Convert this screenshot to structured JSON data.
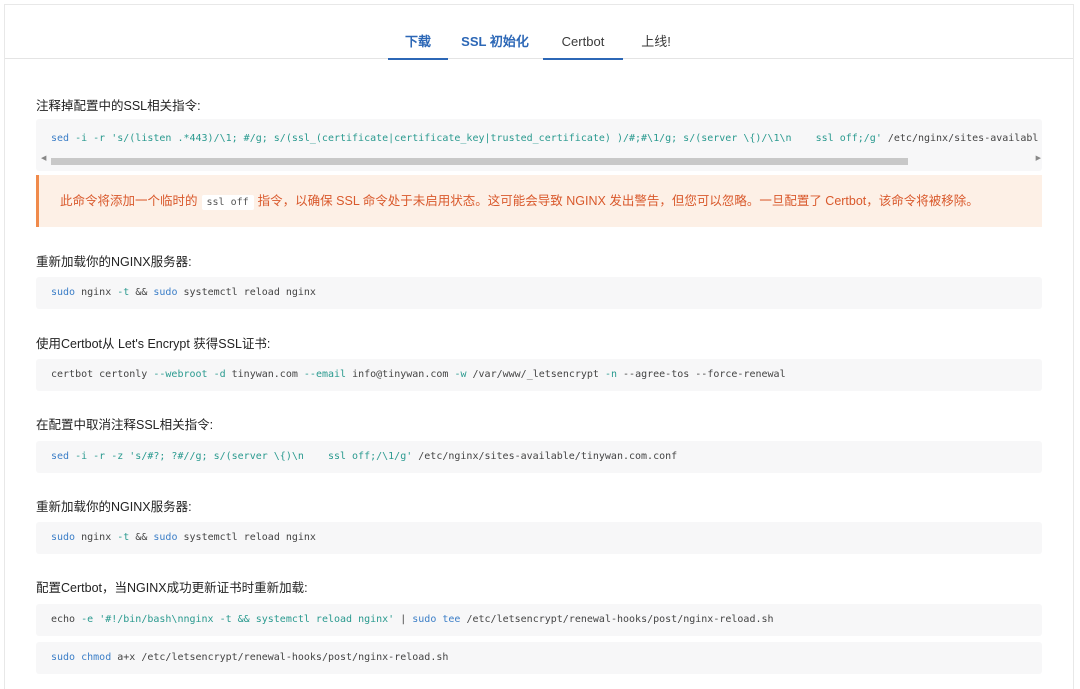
{
  "tabs": [
    {
      "label": "下载"
    },
    {
      "label": "SSL 初始化"
    },
    {
      "label": "Certbot"
    },
    {
      "label": "上线!"
    }
  ],
  "sections": {
    "s1_heading": "注释掉配置中的SSL相关指令:",
    "s2_heading": "重新加载你的NGINX服务器:",
    "s3_heading": "使用Certbot从 Let's Encrypt 获得SSL证书:",
    "s4_heading": "在配置中取消注释SSL相关指令:",
    "s5_heading": "重新加载你的NGINX服务器:",
    "s6_heading": "配置Certbot，当NGINX成功更新证书时重新加载:"
  },
  "warning": {
    "before": "此命令将添加一个临时的",
    "code": "ssl off",
    "after": "指令，以确保 SSL 命令处于未启用状态。这可能会导致 NGINX 发出警告，但您可以忽略。一旦配置了 Certbot，该命令将被移除。"
  },
  "code": {
    "c1": {
      "cmd": "sed",
      "args": " -i -r ",
      "str": "'s/(listen .*443)/\\1; #/g; s/(ssl_(certificate|certificate_key|trusted_certificate) )/#;#\\1/g; s/(server \\{)/\\1\\n    ssl off;/g'",
      "rest": " /etc/nginx/sites-availabl"
    },
    "c2": {
      "a": "sudo",
      "b": " nginx ",
      "c": "-t",
      "d": " && ",
      "e": "sudo",
      "f": " systemctl reload nginx"
    },
    "c3": {
      "a": "certbot certonly ",
      "b": "--webroot",
      "c": " ",
      "d": "-d",
      "e": " tinywan.com ",
      "f": "--email",
      "g": " info@tinywan.com ",
      "h": "-w",
      "i": " /var/www/_letsencrypt ",
      "j": "-n",
      "k": " --agree-tos --force-renewal"
    },
    "c4": {
      "cmd": "sed",
      "args": " -i -r -z ",
      "str": "'s/#?; ?#//g; s/(server \\{)\\n    ssl off;/\\1/g'",
      "rest": " /etc/nginx/sites-available/tinywan.com.conf"
    },
    "c5": {
      "a": "sudo",
      "b": " nginx ",
      "c": "-t",
      "d": " && ",
      "e": "sudo",
      "f": " systemctl reload nginx"
    },
    "c6": {
      "a": "echo ",
      "b": "-e",
      "c": " ",
      "d": "'#!/bin/bash\\nnginx -t && systemctl reload nginx'",
      "e": " | ",
      "f": "sudo",
      "g": " ",
      "h": "tee",
      "i": " /etc/letsencrypt/renewal-hooks/post/nginx-reload.sh"
    },
    "c7": {
      "a": "sudo",
      "b": " ",
      "c": "chmod",
      "d": " a+x /etc/letsencrypt/renewal-hooks/post/nginx-reload.sh"
    }
  }
}
